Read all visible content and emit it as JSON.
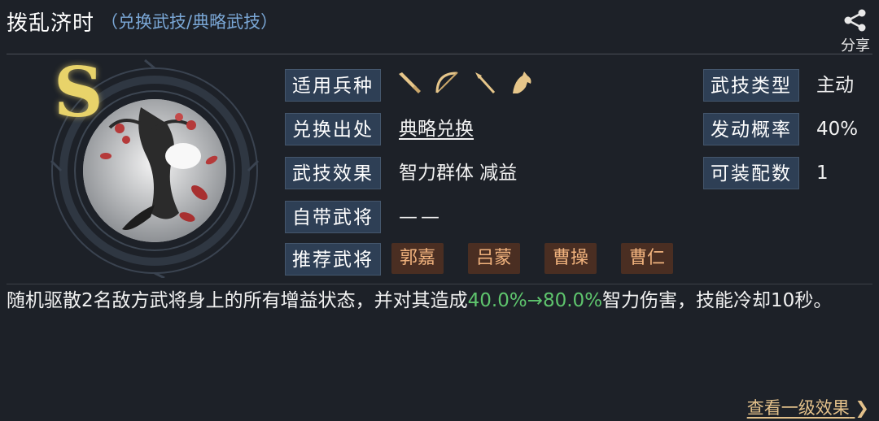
{
  "header": {
    "title": "拨乱济时",
    "subtitle": "（兑换武技/典略武技）",
    "share_label": "分享"
  },
  "skill": {
    "grade": "S",
    "rows": [
      {
        "label": "适用兵种",
        "weapon_icons": [
          "sword-icon",
          "bow-icon",
          "spear-icon",
          "horse-icon"
        ]
      },
      {
        "label": "兑换出处",
        "value": "典略兑换"
      },
      {
        "label": "武技效果",
        "value": "智力群体 减益"
      },
      {
        "label": "自带武将",
        "value": "——"
      },
      {
        "label": "推荐武将",
        "generals": [
          "郭嘉",
          "吕蒙",
          "曹操",
          "曹仁"
        ]
      }
    ],
    "stats": [
      {
        "label": "武技类型",
        "value": "主动"
      },
      {
        "label": "发动概率",
        "value": "40%"
      },
      {
        "label": "可装配数",
        "value": "1"
      }
    ]
  },
  "description": {
    "prefix": "随机驱散2名敌方武将身上的所有增益状态，并对其造成",
    "highlight": "40.0%→80.0%",
    "suffix": "智力伤害，技能冷却10秒。"
  },
  "footer": {
    "more_label": "查看一级效果"
  },
  "colors": {
    "background": "#1d2128",
    "label_bg": "#2e3f55",
    "tag_bg": "#4a2e22",
    "tag_text": "#f0b27d",
    "highlight": "#5ec46d",
    "grade": "#e8d36a",
    "link": "#e2c08a"
  }
}
